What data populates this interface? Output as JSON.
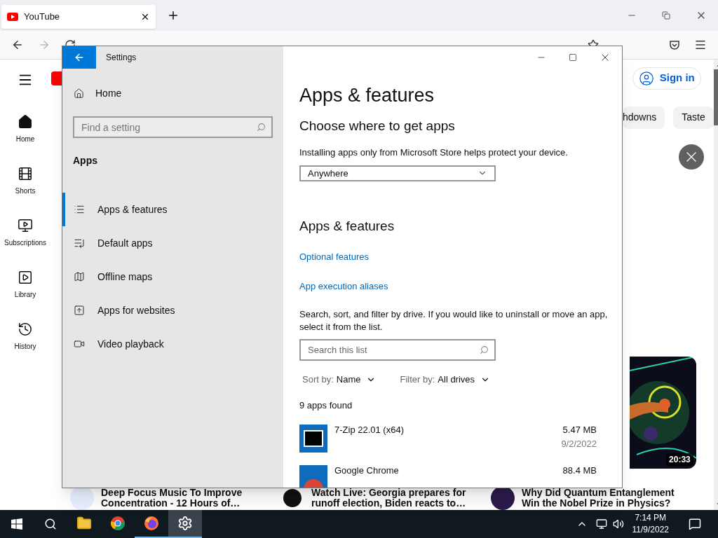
{
  "browser": {
    "tabs": [
      {
        "title": "YouTube",
        "selected": true
      }
    ],
    "forward_disabled": true
  },
  "youtube": {
    "sidebar": [
      {
        "kind": "home",
        "label": "Home",
        "selected": true
      },
      {
        "kind": "shorts",
        "label": "Shorts",
        "selected": false
      },
      {
        "kind": "subscriptions",
        "label": "Subscriptions",
        "selected": false
      },
      {
        "kind": "library",
        "label": "Library",
        "selected": false
      },
      {
        "kind": "history",
        "label": "History",
        "selected": false
      }
    ],
    "sign_in": "Sign in",
    "chips": [
      "hdowns",
      "Taste"
    ],
    "thumbnail": {
      "kind": "picture",
      "duration": "20:33"
    },
    "videos": [
      {
        "lines": [
          "Deep Focus Music To Improve",
          "Concentration - 12 Hours of…"
        ]
      },
      {
        "lines": [
          "Watch Live: Georgia prepares for",
          "runoff election, Biden reacts to…"
        ]
      },
      {
        "lines": [
          "Why Did Quantum Entanglement",
          "Win the Nobel Prize in Physics?"
        ]
      }
    ]
  },
  "settings": {
    "title": "Settings",
    "home": "Home",
    "search_placeholder": "Find a setting",
    "section": "Apps",
    "nav": [
      {
        "kind": "list",
        "label": "Apps & features",
        "selected": true
      },
      {
        "kind": "default",
        "label": "Default apps",
        "selected": false
      },
      {
        "kind": "map",
        "label": "Offline maps",
        "selected": false
      },
      {
        "kind": "web",
        "label": "Apps for websites",
        "selected": false
      },
      {
        "kind": "video",
        "label": "Video playback",
        "selected": false
      }
    ],
    "page_title": "Apps & features",
    "subheading": "Choose where to get apps",
    "description": "Installing apps only from Microsoft Store helps protect your device.",
    "source": "Anywhere",
    "section_heading": "Apps & features",
    "links": [
      "Optional features",
      "App execution aliases"
    ],
    "list_help": "Search, sort, and filter by drive. If you would like to uninstall or move an app, select it from the list.",
    "list_search_placeholder": "Search this list",
    "sort_label": "Sort by:",
    "sort_value": "Name",
    "filter_label": "Filter by:",
    "filter_value": "All drives",
    "count": "9 apps found",
    "apps": [
      {
        "kind": "sevenzip",
        "name": "7-Zip 22.01 (x64)",
        "size": "5.47 MB",
        "date": "9/2/2022"
      },
      {
        "kind": "chrome",
        "name": "Google Chrome",
        "size": "88.4 MB"
      }
    ]
  },
  "taskbar": {
    "apps": [
      {
        "kind": "explorer",
        "running": false,
        "active": false
      },
      {
        "kind": "chrome",
        "running": false,
        "active": false
      },
      {
        "kind": "firefox",
        "running": true,
        "active": false
      },
      {
        "kind": "settings",
        "running": true,
        "active": true
      }
    ],
    "time": "7:14 PM",
    "date": "11/9/2022"
  }
}
